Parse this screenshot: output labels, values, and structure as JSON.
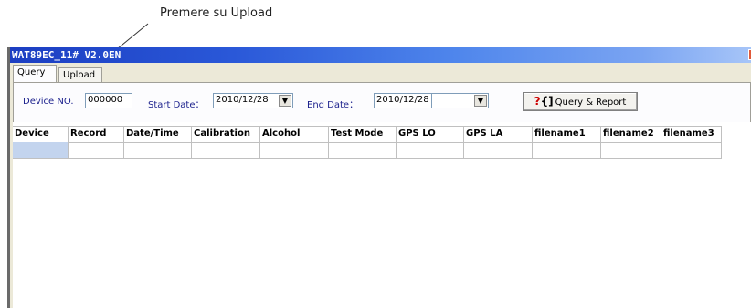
{
  "annotation": {
    "text": "Premere su Upload"
  },
  "window": {
    "title": "WAT89EC_11# V2.0EN"
  },
  "tabs": [
    {
      "label": "Query",
      "active": true
    },
    {
      "label": "Upload",
      "active": false
    }
  ],
  "form": {
    "device_label": "Device NO.",
    "device_value": "000000",
    "start_label": "Start Date：",
    "start_value": "2010/12/28",
    "end_label": "End Date：",
    "end_value": "2010/12/28",
    "end_combo_value": "",
    "report_button": "Query & Report",
    "report_icon": "query-report-icon"
  },
  "grid": {
    "columns": [
      "Device",
      "Record",
      "Date/Time",
      "Calibration",
      "Alcohol",
      "Test Mode",
      "GPS LO",
      "GPS LA",
      "filename1",
      "filename2",
      "filename3"
    ],
    "rows": [
      [
        "",
        "",
        "",
        "",
        "",
        "",
        "",
        "",
        "",
        "",
        ""
      ]
    ],
    "selected_color": "#c3d4ee"
  },
  "colors": {
    "titlebar_start": "#1c3ec2",
    "titlebar_end": "#a8c6f8",
    "label_text": "#1a1f8c",
    "report_icon": "#cc0000"
  }
}
